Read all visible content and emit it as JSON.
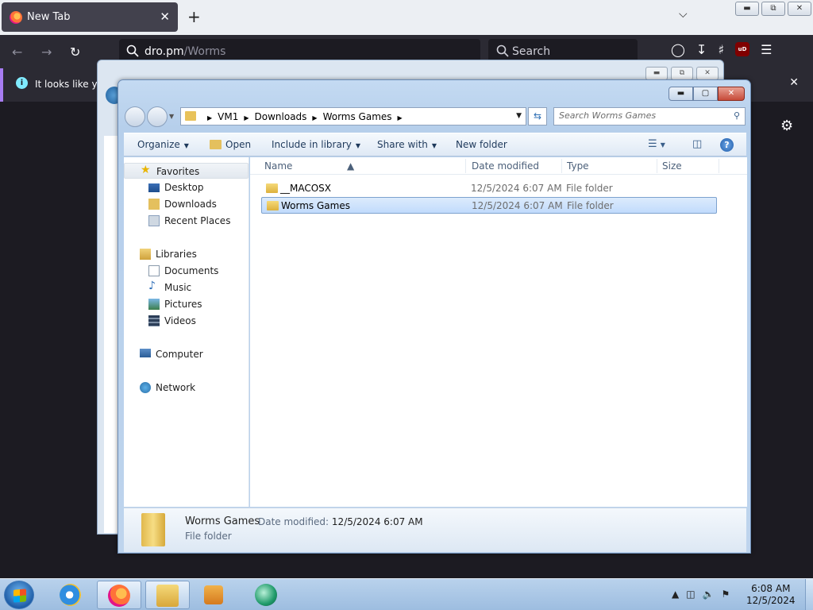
{
  "firefox": {
    "tab_title": "New Tab",
    "tab_close": "✕",
    "new_tab": "+",
    "tab_list": "⌄",
    "url_host": "dro.pm",
    "url_path": "/Worms",
    "search_placeholder": "Search",
    "ublock_label": "uD",
    "notice_text": "It looks like you",
    "notice_close": "✕"
  },
  "bg_window": {},
  "explorer": {
    "breadcrumbs": [
      "VM1",
      "Downloads",
      "Worms Games"
    ],
    "search_placeholder": "Search Worms Games",
    "toolbar": {
      "organize": "Organize",
      "open": "Open",
      "include_in_library": "Include in library",
      "share_with": "Share with",
      "new_folder": "New folder"
    },
    "nav": {
      "favorites": "Favorites",
      "desktop": "Desktop",
      "downloads": "Downloads",
      "recent_places": "Recent Places",
      "libraries": "Libraries",
      "documents": "Documents",
      "music": "Music",
      "pictures": "Pictures",
      "videos": "Videos",
      "computer": "Computer",
      "network": "Network"
    },
    "columns": {
      "name": "Name",
      "date_modified": "Date modified",
      "type": "Type",
      "size": "Size"
    },
    "files": [
      {
        "name": "__MACOSX",
        "date": "12/5/2024 6:07 AM",
        "type": "File folder"
      },
      {
        "name": "Worms Games",
        "date": "12/5/2024 6:07 AM",
        "type": "File folder"
      }
    ],
    "details": {
      "name": "Worms Games",
      "date_label": "Date modified:",
      "date_value": "12/5/2024 6:07 AM",
      "type": "File folder"
    }
  },
  "taskbar": {
    "time": "6:08 AM",
    "date": "12/5/2024"
  },
  "colors": {
    "firefox_dark": "#2b2a33",
    "selection": "#c1dbfc",
    "taskbar": "#b9d2ec"
  }
}
